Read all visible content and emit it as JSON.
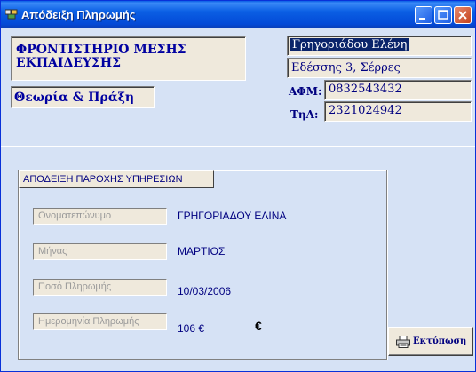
{
  "window": {
    "title": "Απόδειξη Πληρωμής",
    "controls": {
      "minimize_icon": "minimize-icon",
      "maximize_icon": "maximize-icon",
      "close_icon": "close-icon"
    }
  },
  "header": {
    "organization": "ΦΡΟΝΤΙΣΤΗΡΙΟ ΜΕΣΗΣ ΕΚΠΑΙΔΕΥΣΗΣ",
    "subtitle": "Θεωρία & Πράξη"
  },
  "customer": {
    "name": "Γρηγοριάδου Ελένη",
    "address": "Εδέσσης 3, Σέρρες",
    "afm_label": "ΑΦΜ:",
    "afm": "0832543432",
    "phone_label": "ΤηΛ:",
    "phone": "2321024942"
  },
  "receipt": {
    "group_title": "ΑΠΟΔΕΙΞΗ ΠΑΡΟΧΗΣ ΥΠΗΡΕΣΙΩΝ",
    "rows": [
      {
        "label": "Ονοματεπώνυμο",
        "value": "ΓΡΗΓΟΡΙΑΔΟΥ ΕΛΙΝΑ"
      },
      {
        "label": "Μήνας",
        "value": "ΜΑΡΤΙΟΣ"
      },
      {
        "label": "Ποσό Πληρωμής",
        "value": "10/03/2006"
      },
      {
        "label": "Ημερομηνία Πληρωμής",
        "value": "106 €"
      }
    ],
    "currency_symbol": "€"
  },
  "actions": {
    "print_label": "Εκτύπωση",
    "print_icon": "printer-icon"
  },
  "colors": {
    "titlebar": "#0349d6",
    "window_bg": "#d6e2f5",
    "field_bg": "#efe9dc",
    "text_navy": "#000080",
    "selection": "#0a246a"
  }
}
